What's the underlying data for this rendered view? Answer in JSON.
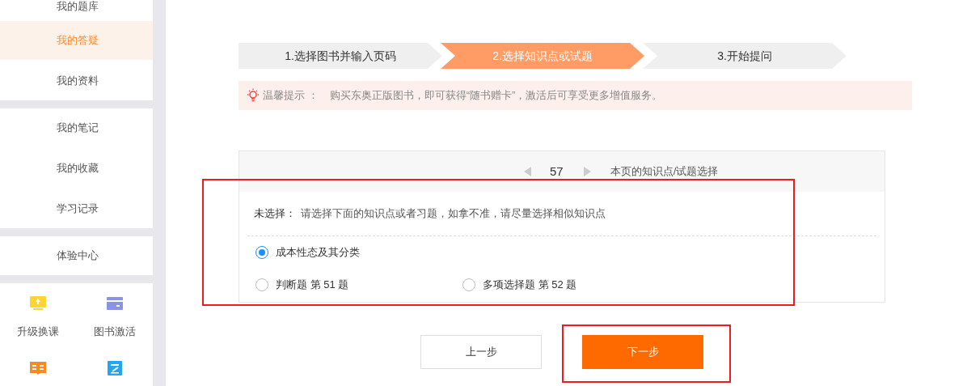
{
  "sidebar": {
    "groups": [
      {
        "items": [
          {
            "label": "我的题库",
            "selected": false
          },
          {
            "label": "我的答疑",
            "selected": true
          },
          {
            "label": "我的资料",
            "selected": false
          }
        ]
      },
      {
        "items": [
          {
            "label": "我的笔记",
            "selected": false
          },
          {
            "label": "我的收藏",
            "selected": false
          },
          {
            "label": "学习记录",
            "selected": false
          }
        ]
      },
      {
        "items": [
          {
            "label": "体验中心",
            "selected": false
          }
        ]
      }
    ],
    "shortcuts": [
      {
        "kind": "upgrade",
        "label": "升级换课"
      },
      {
        "kind": "card",
        "label": "图书激活"
      },
      {
        "kind": "book"
      },
      {
        "kind": "note"
      }
    ]
  },
  "steps": [
    {
      "label": "1.选择图书并输入页码",
      "selected": false
    },
    {
      "label": "2.选择知识点或试题",
      "selected": true
    },
    {
      "label": "3.开始提问",
      "selected": false
    }
  ],
  "tip": {
    "title": "温馨提示 ：",
    "text": "购买东奥正版图书，即可获得“随书赠卡”，激活后可享受更多增值服务。"
  },
  "panel": {
    "page": "57",
    "title": "本页的知识点/试题选择",
    "highlighted": true,
    "status_label": "未选择：",
    "status_text": "请选择下面的知识点或者习题，如拿不准，请尽量选择相似知识点",
    "options": [
      [
        {
          "label": "成本性态及其分类",
          "selected": true
        }
      ],
      [
        {
          "label": "判断题 第 51 题",
          "selected": false
        },
        {
          "label": "多项选择题 第 52 题",
          "selected": false
        }
      ]
    ]
  },
  "buttons": {
    "prev": {
      "label": "上一步"
    },
    "next": {
      "label": "下一步",
      "highlighted": true
    }
  }
}
